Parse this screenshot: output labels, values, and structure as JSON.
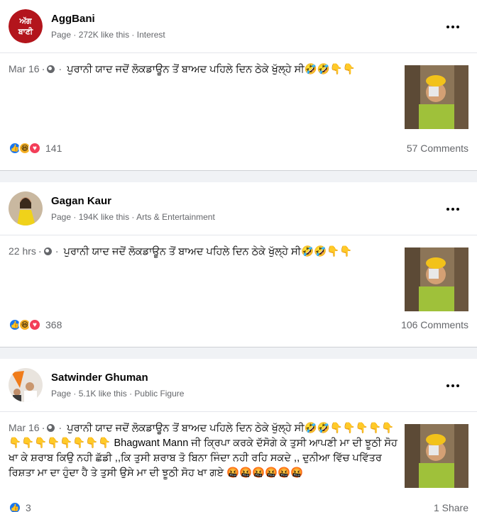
{
  "posts": [
    {
      "page_name": "AggBani",
      "page_type": "Page",
      "likes": "272K like this",
      "category": "Interest",
      "avatar_text": "ਅੱਗ ਬਾਣੀ",
      "time": "Mar 16",
      "text": "ਪੁਰਾਨੀ ਯਾਦ ਜਦੋਂ ਲੋਕਡਾਊਨ ਤੋਂ ਬਾਅਦ ਪਹਿਲੇ ਦਿਨ ਠੇਕੇ ਖੁੱਲ੍ਹੇ ਸੀ🤣🤣👇👇",
      "reaction_count": "141",
      "comments": "57 Comments"
    },
    {
      "page_name": "Gagan Kaur",
      "page_type": "Page",
      "likes": "194K like this",
      "category": "Arts & Entertainment",
      "time": "22 hrs",
      "text": "ਪੁਰਾਨੀ ਯਾਦ ਜਦੋਂ ਲੋਕਡਾਊਨ ਤੋਂ ਬਾਅਦ ਪਹਿਲੇ ਦਿਨ ਠੇਕੇ ਖੁੱਲ੍ਹੇ ਸੀ🤣🤣👇👇",
      "reaction_count": "368",
      "comments": "106 Comments"
    },
    {
      "page_name": "Satwinder Ghuman",
      "page_type": "Page",
      "likes": "5.1K like this",
      "category": "Public Figure",
      "time": "Mar 16",
      "text": "ਪੁਰਾਨੀ ਯਾਦ ਜਦੋਂ ਲੋਕਡਾਊਨ ਤੋਂ ਬਾਅਦ ਪਹਿਲੇ ਦਿਨ ਠੇਕੇ ਖੁੱਲ੍ਹੇ ਸੀ🤣🤣👇👇👇👇👇👇👇👇👇👇👇👇👇 Bhagwant Mann ਜੀ ਕ੍ਰਿਪਾ ਕਰਕੇ ਦੱਸੋਗੇ ਕੇ ਤੁਸੀ ਆਪਣੀ ਮਾ ਦੀ ਝੂਠੀ ਸੋਹ ਖਾ ਕੇ ਸ਼ਰਾਬ ਕਿਉ ਨਹੀ ਛੱਡੀ ,,ਕਿ ਤੁਸੀ ਸ਼ਰਾਬ ਤੋ ਬਿਨਾ ਜਿੰਦਾ ਨਹੀ ਰਹਿ ਸਕਦੇ ,, ਦੁਨੀਆ ਵਿੱਚ ਪਵਿੱਤਰ ਰਿਸ਼ਤਾ ਮਾ ਦਾ ਹੁੰਦਾ ਹੈ ਤੇ ਤੁਸੀ ਉਸੇ ਮਾ ਦੀ ਝੂਠੀ ਸੋਹ ਖਾ ਗਏ 🤬🤬🤬🤬🤬🤬",
      "reaction_count": "3",
      "comments": "1 Share"
    }
  ],
  "colors": {
    "like": "#1877f2",
    "haha": "#f7b125",
    "love": "#f33e58",
    "secondary_text": "#65676b",
    "avatar_red": "#b3151c"
  },
  "icons": [
    "globe-icon",
    "more-options-icon",
    "like-reaction-icon",
    "haha-reaction-icon",
    "love-reaction-icon"
  ]
}
